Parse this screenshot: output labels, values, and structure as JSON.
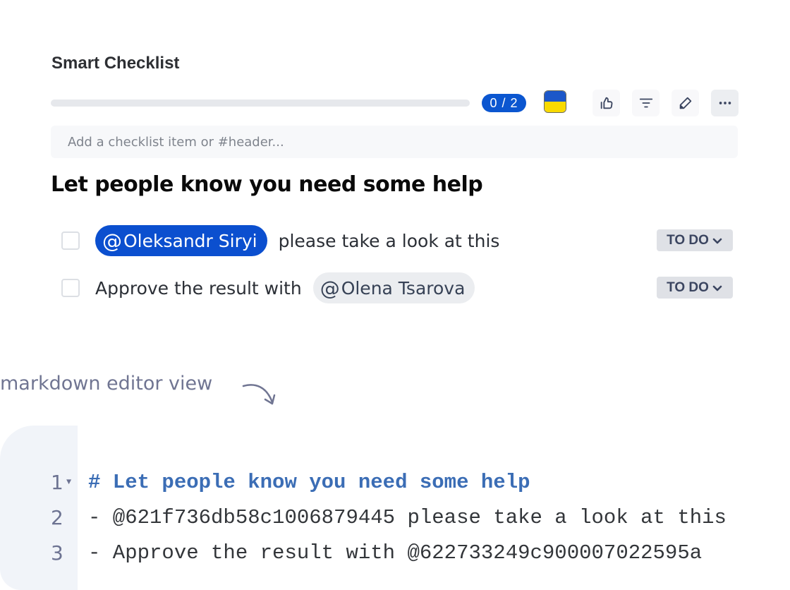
{
  "checklist": {
    "title": "Smart Checklist",
    "progress": {
      "completed": 0,
      "total": 2,
      "label": "0 / 2",
      "fraction": 0
    },
    "flag_colors": {
      "top": "#1c57c9",
      "bottom": "#f9da00"
    },
    "toolbar": {
      "like": "thumbs-up-icon",
      "filter": "filter-icon",
      "edit": "pencil-icon",
      "more": "more-icon"
    },
    "add_item": {
      "placeholder": "Add a checklist item or #header...",
      "value": ""
    },
    "section_header": "Let people know you need some help",
    "items": [
      {
        "checked": false,
        "mention": {
          "at": "@",
          "name": "Oleksandr Siryi",
          "style": "primary"
        },
        "text_after": "please take a look at this",
        "status": "TO DO"
      },
      {
        "checked": false,
        "text_before": "Approve the result with",
        "mention": {
          "at": "@",
          "name": "Olena Tsarova",
          "style": "secondary"
        },
        "status": "TO DO"
      }
    ]
  },
  "annotation": {
    "label": "markdown editor view"
  },
  "editor": {
    "lines": [
      {
        "number": "1",
        "text": "# Let people know you need some help",
        "type": "heading",
        "foldable": true
      },
      {
        "number": "2",
        "text": "- @621f736db58c1006879445 please take a look at this",
        "type": "item",
        "foldable": false
      },
      {
        "number": "3",
        "text": "- Approve the result with @622733249c900007022595a",
        "type": "item",
        "foldable": false
      }
    ]
  },
  "colors": {
    "accent": "#0b4fcf",
    "status_bg": "#dfe1e6",
    "heading_code": "#3b6db5",
    "annotation": "#707592"
  }
}
